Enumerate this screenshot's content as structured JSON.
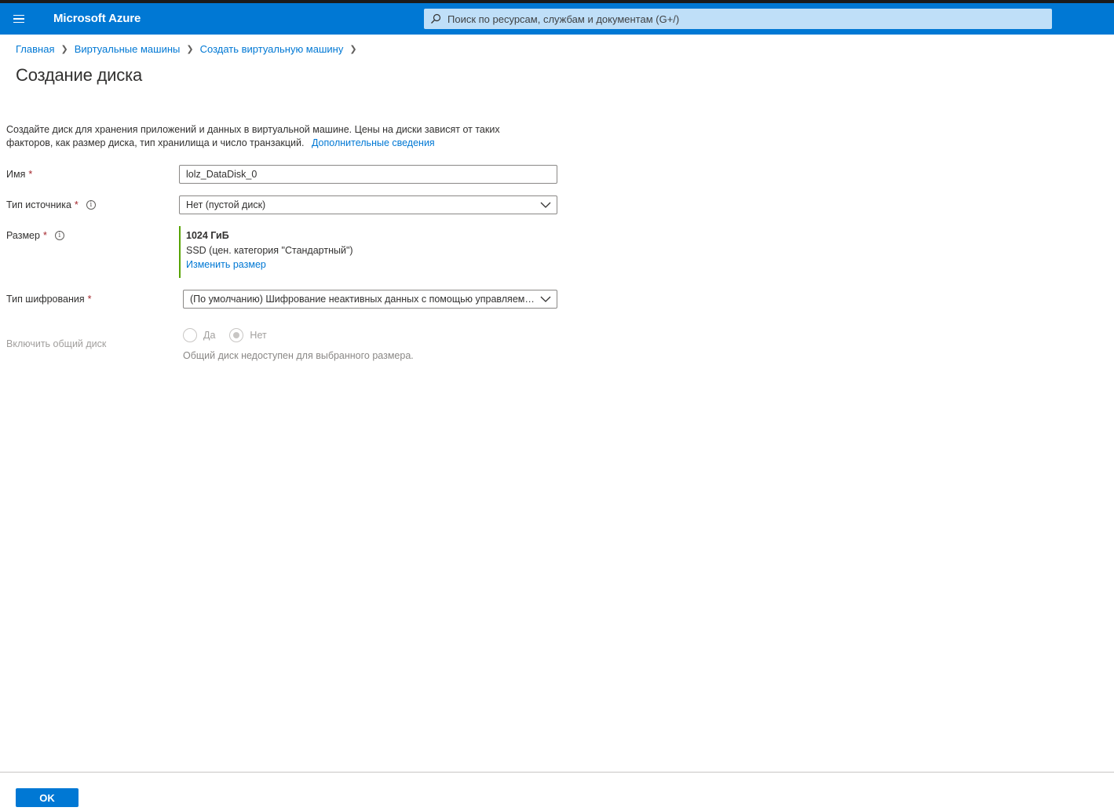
{
  "header": {
    "brand": "Microsoft Azure",
    "search_placeholder": "Поиск по ресурсам, службам и документам (G+/)",
    "accent_color": "#0078d4"
  },
  "breadcrumb": {
    "items": [
      "Главная",
      "Виртуальные машины",
      "Создать виртуальную машину"
    ]
  },
  "page": {
    "title": "Создание диска",
    "description": "Создайте диск для хранения приложений и данных в виртуальной машине. Цены на диски зависят от таких факторов, как размер диска, тип хранилища и число транзакций.",
    "learn_more": "Дополнительные сведения"
  },
  "form": {
    "name": {
      "label": "Имя",
      "required": "*",
      "value": "lolz_DataDisk_0"
    },
    "source_type": {
      "label": "Тип источника",
      "required": "*",
      "value": "Нет (пустой диск)"
    },
    "size": {
      "label": "Размер",
      "required": "*",
      "value": "1024 ГиБ",
      "tier": "SSD (цен. категория \"Стандартный\")",
      "change_link": "Изменить размер"
    },
    "encryption": {
      "label": "Тип шифрования",
      "required": "*",
      "value": "(По умолчанию) Шифрование неактивных данных с помощью управляемого платформой ключа"
    },
    "shared_disk": {
      "label": "Включить общий диск",
      "options": [
        "Да",
        "Нет"
      ],
      "selected": "Нет",
      "disabled": true,
      "hint": "Общий диск недоступен для выбранного размера."
    }
  },
  "footer": {
    "ok_label": "OK"
  }
}
